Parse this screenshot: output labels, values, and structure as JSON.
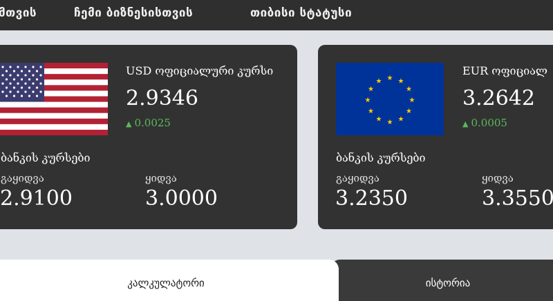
{
  "nav": {
    "items": [
      "მთვის",
      "ჩემი ბიზნესისთვის",
      "თიბისი სტატუსი"
    ]
  },
  "cards": [
    {
      "currency_title": "USD ოფიციალური კურსი",
      "rate": "2.9346",
      "change": "0.0025",
      "change_direction": "up",
      "flag": "usa-flag",
      "bank_heading": "ბანკის კურსები",
      "buy_label": "გაყიდვა",
      "buy_value": "2.9100",
      "sell_label": "ყიდვა",
      "sell_value": "3.0000"
    },
    {
      "currency_title": "EUR ოფიციალ",
      "rate": "3.2642",
      "change": "0.0005",
      "change_direction": "up",
      "flag": "eu-flag",
      "bank_heading": "ბანკის კურსები",
      "buy_label": "გაყიდვა",
      "buy_value": "3.2350",
      "sell_label": "ყიდვა",
      "sell_value": "3.3550"
    }
  ],
  "tabs": {
    "calculator": "კალკულატორი",
    "history": "ისტორია"
  },
  "icons": {
    "change_up": "caret-up-icon"
  },
  "colors": {
    "nav_bg": "#2f2f2f",
    "card_bg": "#323232",
    "page_bg": "#dfe3e8",
    "positive_change": "#5cb85c",
    "eu_blue": "#003399",
    "eu_star": "#ffcc00",
    "us_red": "#b22234",
    "us_blue": "#3c3b6e"
  }
}
